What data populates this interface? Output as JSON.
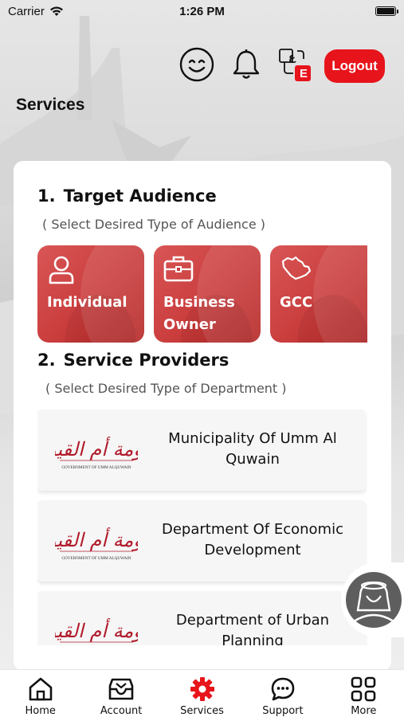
{
  "status_bar": {
    "carrier": "Carrier",
    "time": "1:26 PM"
  },
  "header": {
    "logout_label": "Logout",
    "language_badge": "E",
    "language_glyph": "ع"
  },
  "page_title": "Services",
  "target_audience": {
    "number": "1.",
    "title": "Target Audience",
    "subtitle": "( Select Desired Type of Audience )",
    "tiles": [
      {
        "label": "Individual",
        "icon": "person-icon"
      },
      {
        "label": "Business Owner",
        "icon": "briefcase-icon"
      },
      {
        "label": "GCC",
        "icon": "gcc-map-icon"
      }
    ]
  },
  "service_providers": {
    "number": "2.",
    "title": "Service Providers",
    "subtitle": "( Select Desired Type of Department )",
    "logo_arabic": "حكومة أم القيوين",
    "logo_english": "GOVERNMENT OF UMM ALQUWAIN",
    "items": [
      {
        "name": "Municipality Of Umm Al Quwain"
      },
      {
        "name": "Department Of Economic Development"
      },
      {
        "name": "Department of Urban Planning"
      }
    ]
  },
  "bottom_nav": [
    {
      "label": "Home",
      "icon": "home-icon",
      "active": false
    },
    {
      "label": "Account",
      "icon": "inbox-icon",
      "active": false
    },
    {
      "label": "Services",
      "icon": "gear-icon",
      "active": true
    },
    {
      "label": "Support",
      "icon": "chat-icon",
      "active": false
    },
    {
      "label": "More",
      "icon": "grid-icon",
      "active": false
    }
  ],
  "colors": {
    "brand_red": "#e8141c",
    "tile_red": "#c83a3a",
    "active_nav": "#e8141c"
  }
}
